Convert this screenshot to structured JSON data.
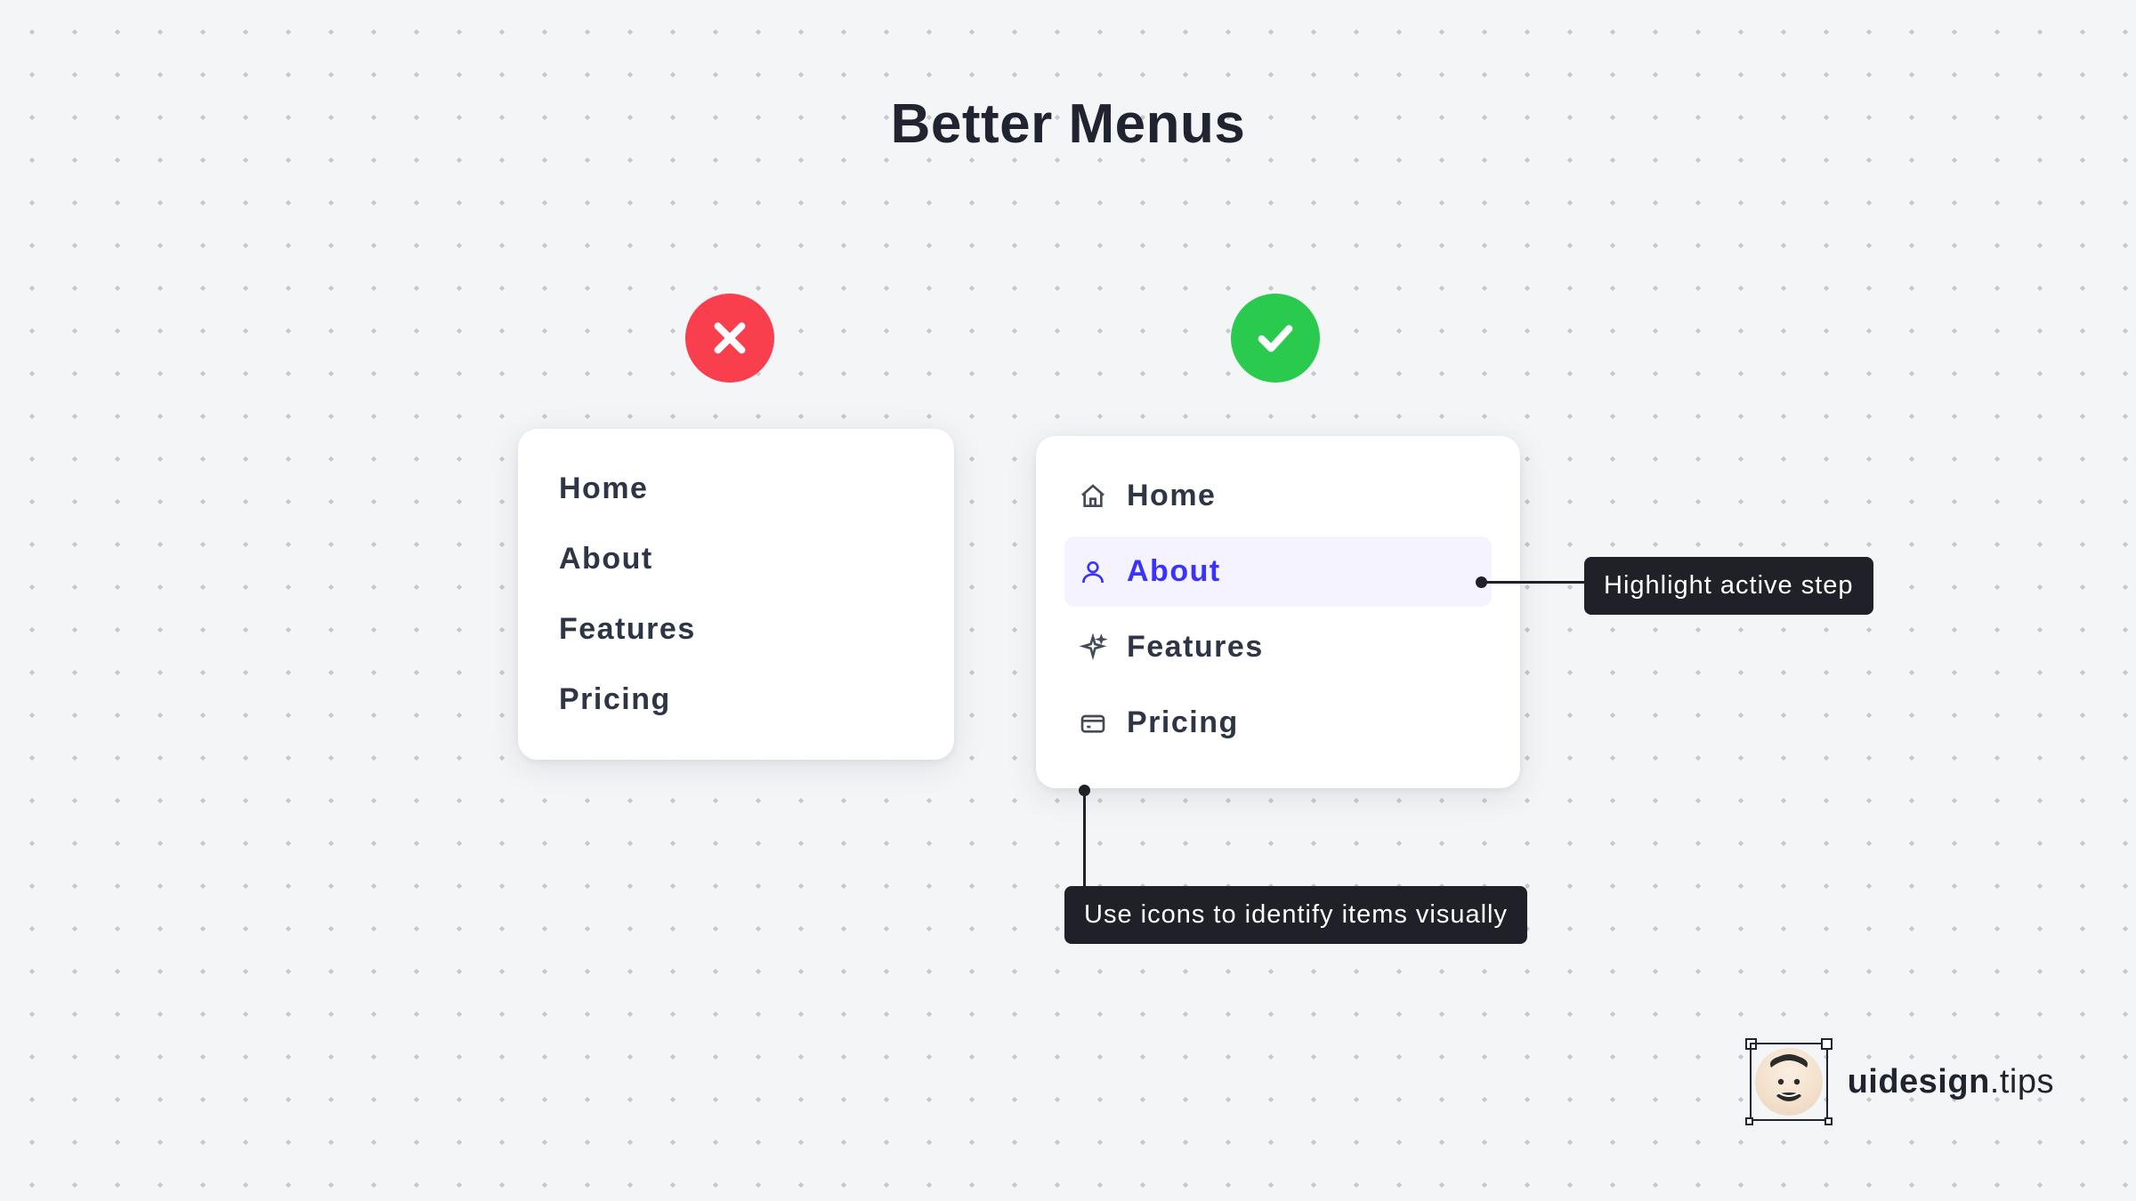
{
  "title": "Better Menus",
  "menu_left": {
    "items": [
      {
        "label": "Home"
      },
      {
        "label": "About"
      },
      {
        "label": "Features"
      },
      {
        "label": "Pricing"
      }
    ]
  },
  "menu_right": {
    "items": [
      {
        "label": "Home",
        "icon": "home-icon",
        "active": false
      },
      {
        "label": "About",
        "icon": "user-icon",
        "active": true
      },
      {
        "label": "Features",
        "icon": "sparkle-icon",
        "active": false
      },
      {
        "label": "Pricing",
        "icon": "card-icon",
        "active": false
      }
    ]
  },
  "tooltips": {
    "highlight": "Highlight active step",
    "icons": "Use icons to identify items visually"
  },
  "footer": {
    "brand_bold": "uidesign",
    "brand_thin": ".tips"
  },
  "colors": {
    "wrong": "#f93e4d",
    "right": "#2aca4f",
    "accent": "#3a33ff",
    "active_bg": "#f4f3ff",
    "tooltip_bg": "#1f2028"
  }
}
